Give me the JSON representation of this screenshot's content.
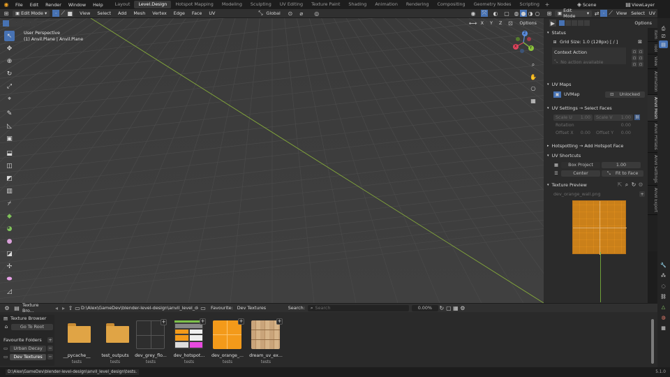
{
  "topbar": {
    "menus": [
      "File",
      "Edit",
      "Render",
      "Window",
      "Help"
    ],
    "workspaces": [
      "Layout",
      "Level.Design",
      "Hotspot Mapping",
      "Modeling",
      "Sculpting",
      "UV Editing",
      "Texture Paint",
      "Shading",
      "Animation",
      "Rendering",
      "Compositing",
      "Geometry Nodes",
      "Scripting"
    ],
    "active_workspace": "Level.Design",
    "scene": "Scene",
    "view_layer": "ViewLayer"
  },
  "viewport_header": {
    "mode": "Edit Mode",
    "menus": [
      "View",
      "Select",
      "Add",
      "Mesh",
      "Vertex",
      "Edge",
      "Face",
      "UV"
    ],
    "orientation": "Global",
    "axes": [
      "X",
      "Y",
      "Z"
    ],
    "options": "Options"
  },
  "viewport": {
    "perspective": "User Perspective",
    "object": "(1) Anvil.Plane | Anvil.Plane",
    "gizmo": {
      "x": "X",
      "y": "Y",
      "z": "Z"
    }
  },
  "uv_header": {
    "mode": "Edit Mode",
    "menus": [
      "View",
      "Select",
      "UV"
    ],
    "options": "Options"
  },
  "npanel": {
    "status": {
      "title": "Status",
      "grid_size": "Grid Size: 1.0  (128px)  [ / ]",
      "context_action": "Context Action",
      "no_action": "No action available"
    },
    "uv_maps": {
      "title": "UV Maps",
      "map_name": "UVMap",
      "lock": "Unlocked"
    },
    "uv_settings": {
      "title": "UV Settings  → Select Faces",
      "scale_u_label": "Scale U",
      "scale_u": "1.00",
      "scale_v_label": "Scale V",
      "scale_v": "1.00",
      "rotation_label": "Rotation",
      "rotation": "0.00",
      "offset_x_label": "Offset X",
      "offset_x": "0.00",
      "offset_y_label": "Offset Y",
      "offset_y": "0.00"
    },
    "hotspotting": "Hotspotting  → Add Hotspot Face",
    "uv_shortcuts": {
      "title": "UV Shortcuts",
      "box_project": "Box Project",
      "box_value": "1.00",
      "center": "Center",
      "fit": "Fit to Face"
    },
    "texture_preview": {
      "title": "Texture Preview",
      "file": "dev_orange_wall.png"
    },
    "tabs": [
      "Item",
      "Tool",
      "View",
      "Animation",
      "Anvil Mesh",
      "Anvil Prefabs",
      "Anvil Settings",
      "Anvil Export"
    ],
    "active_tab": "Anvil Mesh"
  },
  "file_browser": {
    "editor": "Texture Bro...",
    "path": "D:\\Alex\\GameDev\\blender-level-design\\anvil_level_design\\...",
    "favourite_label": "Favourite:",
    "favourite_value": "Dev Textures",
    "search_label": "Search:",
    "search_placeholder": "Search",
    "zoom": "0.00%",
    "side": {
      "title": "Texture Browser",
      "go_root": "Go To Root",
      "folders_title": "Favourite Folders",
      "folders": [
        "Urban Decay",
        "Dev Textures"
      ]
    },
    "items": [
      {
        "name": "__pycache__",
        "sub": "tests",
        "kind": "folder"
      },
      {
        "name": "test_outputs",
        "sub": "tests",
        "kind": "folder"
      },
      {
        "name": "dev_grey_flo...",
        "sub": "tests",
        "kind": "grey"
      },
      {
        "name": "dev_hotspot...",
        "sub": "tests",
        "kind": "hotspot"
      },
      {
        "name": "dev_orange_...",
        "sub": "tests",
        "kind": "orange"
      },
      {
        "name": "dream_uv_ex...",
        "sub": "tests",
        "kind": "wood"
      }
    ],
    "status_path": "D:\\Alex\\GameDev\\blender-level-design\\anvil_level_design\\tests.",
    "version": "5.1.0"
  },
  "colors": {
    "accent": "#4772b3",
    "orange": "#f39a1a",
    "grid_line": "#8cb53a",
    "folder": "#e0a445"
  }
}
